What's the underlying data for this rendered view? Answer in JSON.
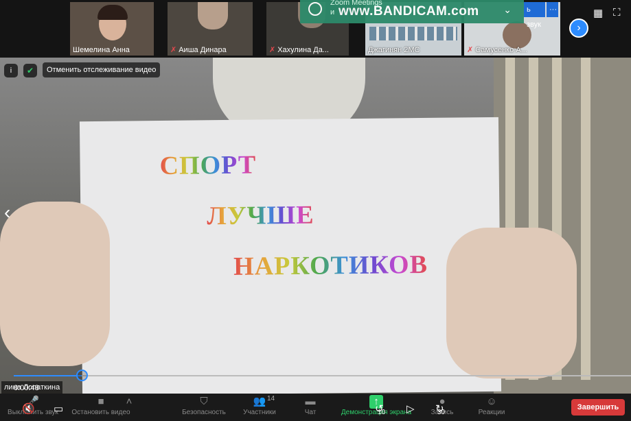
{
  "participants": [
    {
      "name": "Шемелина Анна",
      "muted": false
    },
    {
      "name": "Аиша Динара",
      "muted": true
    },
    {
      "name": "Хахулина Да...",
      "muted": true
    },
    {
      "name": "Джагинян 2МС",
      "muted": false
    },
    {
      "name": "Самусенко А...",
      "muted": true
    }
  ],
  "recorder": {
    "title": "Zoom Meetings",
    "subtitle": "и",
    "watermark": "www.BANDICAM.com",
    "audio_btn": "ь звук",
    "more_btn": "···"
  },
  "video": {
    "unfollow_label": "Отменить отслеживание видео",
    "sign_lines": [
      "СПОРТ",
      "ЛУЧШЕ",
      "НАРКОТИКОВ"
    ],
    "speaker": "Лопаткина",
    "speaker_prefix": "лина",
    "time": "0:00:48",
    "progress": 0.11
  },
  "toolbar": {
    "mute": "Выключить звук",
    "stop_video": "Остановить видео",
    "security": "Безопасность",
    "participants": "Участники",
    "participants_count": "14",
    "chat": "Чат",
    "share": "Демонстрация экрана",
    "record": "Запись",
    "reactions": "Реакции",
    "end": "Завершить",
    "rewind": "10",
    "forward": "30"
  },
  "colors": {
    "accent": "#2d8cff",
    "share": "#2fcf6b",
    "end": "#d73a3a"
  }
}
